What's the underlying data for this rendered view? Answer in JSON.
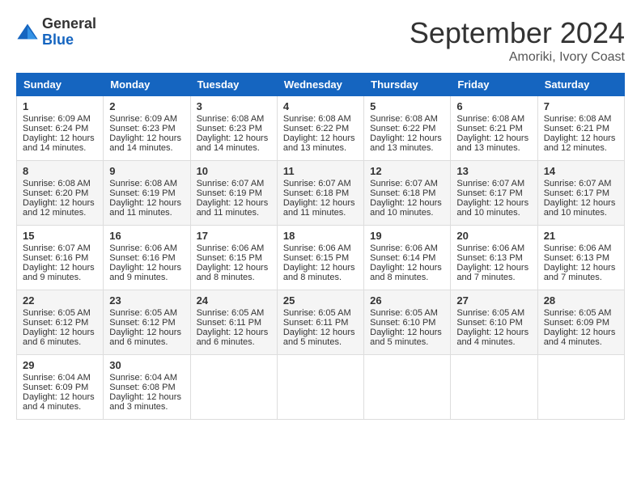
{
  "header": {
    "logo_general": "General",
    "logo_blue": "Blue",
    "month_title": "September 2024",
    "location": "Amoriki, Ivory Coast"
  },
  "days_of_week": [
    "Sunday",
    "Monday",
    "Tuesday",
    "Wednesday",
    "Thursday",
    "Friday",
    "Saturday"
  ],
  "weeks": [
    [
      {
        "day": "1",
        "sunrise": "6:09 AM",
        "sunset": "6:24 PM",
        "daylight": "12 hours and 14 minutes."
      },
      {
        "day": "2",
        "sunrise": "6:09 AM",
        "sunset": "6:23 PM",
        "daylight": "12 hours and 14 minutes."
      },
      {
        "day": "3",
        "sunrise": "6:08 AM",
        "sunset": "6:23 PM",
        "daylight": "12 hours and 14 minutes."
      },
      {
        "day": "4",
        "sunrise": "6:08 AM",
        "sunset": "6:22 PM",
        "daylight": "12 hours and 13 minutes."
      },
      {
        "day": "5",
        "sunrise": "6:08 AM",
        "sunset": "6:22 PM",
        "daylight": "12 hours and 13 minutes."
      },
      {
        "day": "6",
        "sunrise": "6:08 AM",
        "sunset": "6:21 PM",
        "daylight": "12 hours and 13 minutes."
      },
      {
        "day": "7",
        "sunrise": "6:08 AM",
        "sunset": "6:21 PM",
        "daylight": "12 hours and 12 minutes."
      }
    ],
    [
      {
        "day": "8",
        "sunrise": "6:08 AM",
        "sunset": "6:20 PM",
        "daylight": "12 hours and 12 minutes."
      },
      {
        "day": "9",
        "sunrise": "6:08 AM",
        "sunset": "6:19 PM",
        "daylight": "12 hours and 11 minutes."
      },
      {
        "day": "10",
        "sunrise": "6:07 AM",
        "sunset": "6:19 PM",
        "daylight": "12 hours and 11 minutes."
      },
      {
        "day": "11",
        "sunrise": "6:07 AM",
        "sunset": "6:18 PM",
        "daylight": "12 hours and 11 minutes."
      },
      {
        "day": "12",
        "sunrise": "6:07 AM",
        "sunset": "6:18 PM",
        "daylight": "12 hours and 10 minutes."
      },
      {
        "day": "13",
        "sunrise": "6:07 AM",
        "sunset": "6:17 PM",
        "daylight": "12 hours and 10 minutes."
      },
      {
        "day": "14",
        "sunrise": "6:07 AM",
        "sunset": "6:17 PM",
        "daylight": "12 hours and 10 minutes."
      }
    ],
    [
      {
        "day": "15",
        "sunrise": "6:07 AM",
        "sunset": "6:16 PM",
        "daylight": "12 hours and 9 minutes."
      },
      {
        "day": "16",
        "sunrise": "6:06 AM",
        "sunset": "6:16 PM",
        "daylight": "12 hours and 9 minutes."
      },
      {
        "day": "17",
        "sunrise": "6:06 AM",
        "sunset": "6:15 PM",
        "daylight": "12 hours and 8 minutes."
      },
      {
        "day": "18",
        "sunrise": "6:06 AM",
        "sunset": "6:15 PM",
        "daylight": "12 hours and 8 minutes."
      },
      {
        "day": "19",
        "sunrise": "6:06 AM",
        "sunset": "6:14 PM",
        "daylight": "12 hours and 8 minutes."
      },
      {
        "day": "20",
        "sunrise": "6:06 AM",
        "sunset": "6:13 PM",
        "daylight": "12 hours and 7 minutes."
      },
      {
        "day": "21",
        "sunrise": "6:06 AM",
        "sunset": "6:13 PM",
        "daylight": "12 hours and 7 minutes."
      }
    ],
    [
      {
        "day": "22",
        "sunrise": "6:05 AM",
        "sunset": "6:12 PM",
        "daylight": "12 hours and 6 minutes."
      },
      {
        "day": "23",
        "sunrise": "6:05 AM",
        "sunset": "6:12 PM",
        "daylight": "12 hours and 6 minutes."
      },
      {
        "day": "24",
        "sunrise": "6:05 AM",
        "sunset": "6:11 PM",
        "daylight": "12 hours and 6 minutes."
      },
      {
        "day": "25",
        "sunrise": "6:05 AM",
        "sunset": "6:11 PM",
        "daylight": "12 hours and 5 minutes."
      },
      {
        "day": "26",
        "sunrise": "6:05 AM",
        "sunset": "6:10 PM",
        "daylight": "12 hours and 5 minutes."
      },
      {
        "day": "27",
        "sunrise": "6:05 AM",
        "sunset": "6:10 PM",
        "daylight": "12 hours and 4 minutes."
      },
      {
        "day": "28",
        "sunrise": "6:05 AM",
        "sunset": "6:09 PM",
        "daylight": "12 hours and 4 minutes."
      }
    ],
    [
      {
        "day": "29",
        "sunrise": "6:04 AM",
        "sunset": "6:09 PM",
        "daylight": "12 hours and 4 minutes."
      },
      {
        "day": "30",
        "sunrise": "6:04 AM",
        "sunset": "6:08 PM",
        "daylight": "12 hours and 3 minutes."
      },
      null,
      null,
      null,
      null,
      null
    ]
  ]
}
